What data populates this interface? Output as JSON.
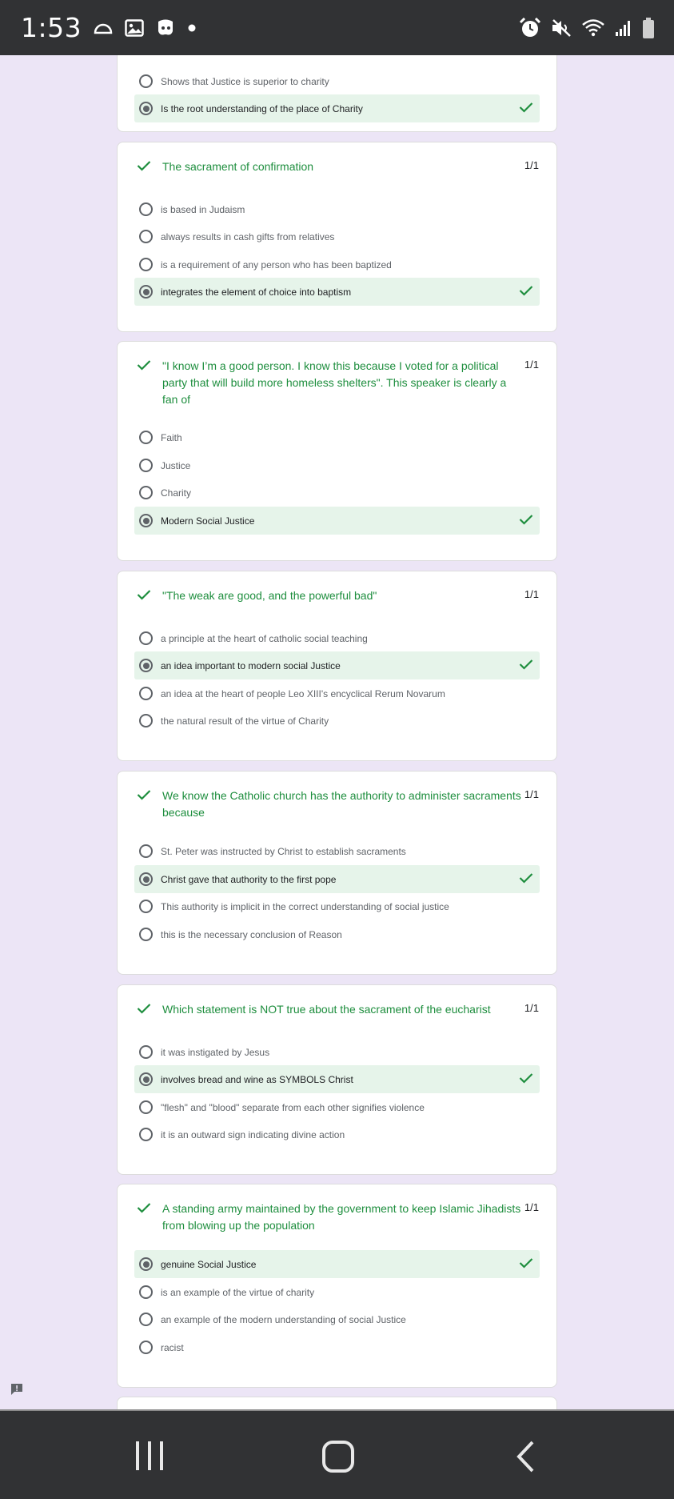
{
  "status_bar": {
    "time": "1:53",
    "left_icons": [
      "cloud-icon",
      "image-icon",
      "game-icon",
      "dot-icon"
    ],
    "right_icons": [
      "alarm-icon",
      "mute-icon",
      "wifi-icon",
      "signal-icon",
      "battery-icon"
    ]
  },
  "questions": [
    {
      "title": "",
      "score": "",
      "options": [
        {
          "label": "Shows that Justice is superior to charity",
          "selected": false,
          "correct": false
        },
        {
          "label": "Is the root understanding of the place of Charity",
          "selected": true,
          "correct": true
        }
      ]
    },
    {
      "title": "The sacrament of confirmation",
      "score": "1/1",
      "options": [
        {
          "label": "is based in Judaism",
          "selected": false,
          "correct": false
        },
        {
          "label": "always results in cash gifts from relatives",
          "selected": false,
          "correct": false
        },
        {
          "label": "is a requirement of any person who has been baptized",
          "selected": false,
          "correct": false
        },
        {
          "label": "integrates the element of choice into baptism",
          "selected": true,
          "correct": true
        }
      ]
    },
    {
      "title": "\"I know I’m a good person. I know this because I voted for a political party that will build more homeless shelters\". This speaker is clearly a fan of",
      "score": "1/1",
      "options": [
        {
          "label": "Faith",
          "selected": false,
          "correct": false
        },
        {
          "label": "Justice",
          "selected": false,
          "correct": false
        },
        {
          "label": "Charity",
          "selected": false,
          "correct": false
        },
        {
          "label": "Modern Social Justice",
          "selected": true,
          "correct": true
        }
      ]
    },
    {
      "title": "\"The weak are good, and the powerful bad\"",
      "score": "1/1",
      "options": [
        {
          "label": "a principle at the heart of catholic social teaching",
          "selected": false,
          "correct": false
        },
        {
          "label": "an idea important to modern social Justice",
          "selected": true,
          "correct": true
        },
        {
          "label": "an idea at the heart of people Leo XIII's encyclical Rerum Novarum",
          "selected": false,
          "correct": false
        },
        {
          "label": "the natural result of the virtue of Charity",
          "selected": false,
          "correct": false
        }
      ]
    },
    {
      "title": "We know the Catholic church has the authority to administer sacraments because",
      "score": "1/1",
      "options": [
        {
          "label": "St. Peter was instructed by Christ to establish sacraments",
          "selected": false,
          "correct": false
        },
        {
          "label": "Christ gave that authority to the first pope",
          "selected": true,
          "correct": true
        },
        {
          "label": "This authority is implicit in the correct understanding of social justice",
          "selected": false,
          "correct": false
        },
        {
          "label": "this is the necessary conclusion of Reason",
          "selected": false,
          "correct": false
        }
      ]
    },
    {
      "title": "Which statement is NOT true about the sacrament of the eucharist",
      "score": "1/1",
      "options": [
        {
          "label": "it was instigated by Jesus",
          "selected": false,
          "correct": false
        },
        {
          "label": "involves bread and wine as SYMBOLS Christ",
          "selected": true,
          "correct": true
        },
        {
          "label": "\"flesh\" and \"blood\" separate from each other signifies violence",
          "selected": false,
          "correct": false
        },
        {
          "label": "it is an outward sign indicating divine action",
          "selected": false,
          "correct": false
        }
      ]
    },
    {
      "title": "A standing army maintained by the government to keep Islamic Jihadists from blowing up the population",
      "score": "1/1",
      "options": [
        {
          "label": "genuine Social Justice",
          "selected": true,
          "correct": true
        },
        {
          "label": "is an example of the virtue of charity",
          "selected": false,
          "correct": false
        },
        {
          "label": "an example of the modern understanding of social Justice",
          "selected": false,
          "correct": false
        },
        {
          "label": "racist",
          "selected": false,
          "correct": false
        }
      ]
    }
  ],
  "nav_bar": {
    "buttons": [
      "recent-apps-icon",
      "home-icon",
      "back-icon"
    ]
  },
  "colors": {
    "background": "#ece5f6",
    "correct_green": "#1e8e3e",
    "correct_bg": "#e6f4ea",
    "system_bar": "#313234"
  }
}
